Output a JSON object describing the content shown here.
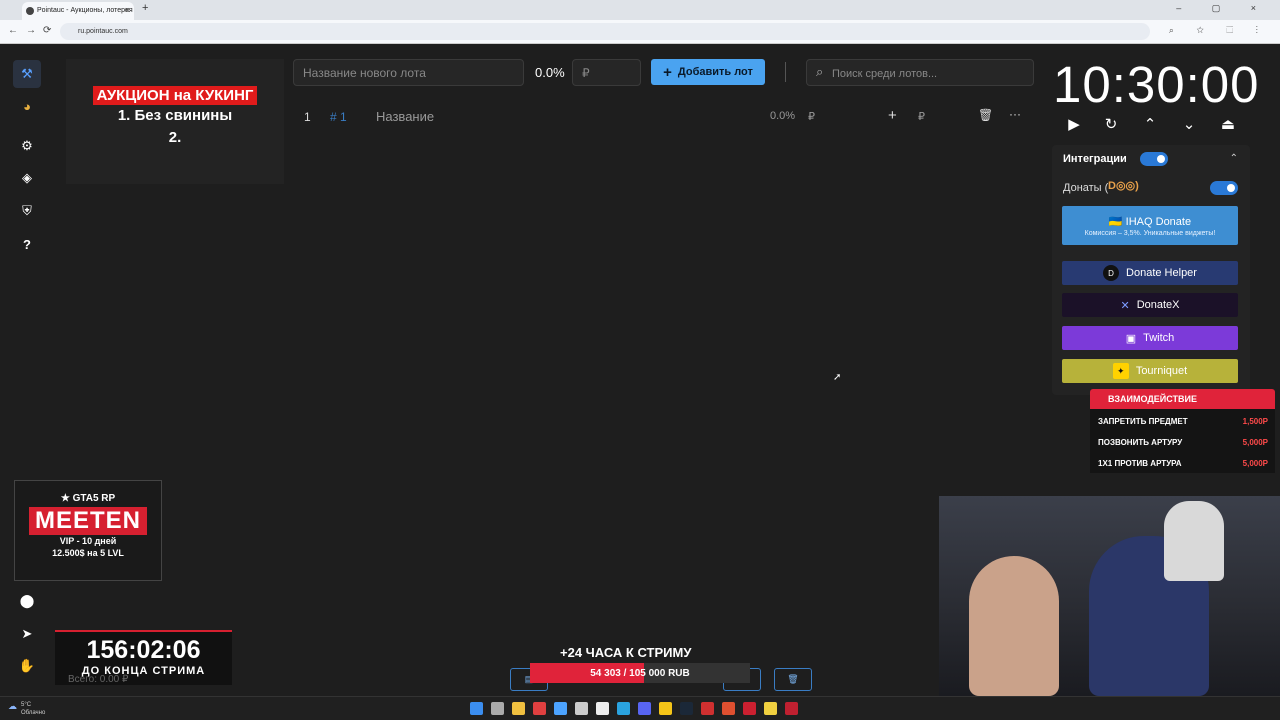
{
  "browser": {
    "tab_title": "Pointauc - Аукционы, лотерея",
    "tab_close": "×",
    "new_tab": "+",
    "window_controls": "– ▢ ×",
    "back": "←",
    "forward": "→",
    "reload": "⟳",
    "url": "ru.pointauc.com",
    "tool_icons": "⌕ ☆ ⬚ ⋮"
  },
  "sidebar": {
    "icons": [
      "hammer-icon",
      "pie-chart-icon",
      "gear-icon",
      "layers-icon",
      "shield-icon",
      "help-icon",
      "github-icon",
      "telegram-icon",
      "donate-hand-icon"
    ],
    "glyphs": [
      "⚒",
      "◕",
      "⚙",
      "◈",
      "⛨",
      "?",
      "⬤",
      "➤",
      "✋"
    ]
  },
  "banner": {
    "title": "АУКЦИОН на КУКИНГ",
    "line1": "1. Без свинины",
    "line2": "2."
  },
  "toolbar": {
    "new_lot_placeholder": "Название нового лота",
    "percent": "0.0%",
    "currency_placeholder": "₽",
    "add_button": "Добавить лот",
    "add_icon": "+",
    "search_placeholder": "Поиск среди лотов...",
    "search_icon": "⌕"
  },
  "lots": [
    {
      "num": "1",
      "id": "# 1",
      "name": "Название",
      "percent": "0.0%",
      "currency": "₽",
      "plus": "+",
      "currency2": "₽",
      "delete": "🗑",
      "more": "···"
    }
  ],
  "timer": {
    "value": "10:30:00",
    "controls": [
      "▶",
      "↻",
      "⌃",
      "⌄",
      "⏏"
    ]
  },
  "integrations": {
    "header": "Интеграции",
    "chevron": "⌃",
    "donates_label": "Донаты (",
    "donates_logo": "D◎◎)",
    "services": [
      {
        "name": "IHAQ Donate",
        "sub": "Комиссия – 3,5%. Уникальные виджеты!",
        "color": "#3e8ed2",
        "icon": "🇺🇦"
      },
      {
        "name": "Donate Helper",
        "color": "#283a72",
        "icon": "D"
      },
      {
        "name": "DonateX",
        "color": "#1b1128",
        "icon": "✕"
      },
      {
        "name": "Twitch",
        "color": "#7c3ad9",
        "icon": "▣"
      },
      {
        "name": "Tourniquet",
        "color": "#b7b23a",
        "icon": "✦"
      }
    ]
  },
  "interaction_overlay": {
    "title": "ВЗАИМОДЕЙСТВИЕ",
    "items": [
      {
        "label": "ЗАПРЕТИТЬ ПРЕДМЕТ",
        "price": "1,500Р"
      },
      {
        "label": "ПОЗВОНИТЬ АРТУРУ",
        "price": "5,000Р"
      },
      {
        "label": "1X1 ПРОТИВ АРТУРА",
        "price": "5,000Р"
      }
    ]
  },
  "gta_banner": {
    "rp": "★ GTA5 RP",
    "name": "MEETEN",
    "line1": "VIP - 10 дней",
    "line2": "12.500$ на 5 LVL"
  },
  "countdown": {
    "time": "156:02:06",
    "label": "ДО КОНЦА СТРИМА"
  },
  "total": "Всего: 0.00 ₽",
  "stream_goal": {
    "title": "+24 ЧАСА К СТРИМУ",
    "progress_text": "54 303 / 105 000 RUB",
    "current": 54303,
    "goal": 105000
  },
  "bottom_buttons": [
    "▤",
    "⇣",
    "⇅",
    "🗑"
  ],
  "taskbar": {
    "temp": "5°C",
    "weather": "Облачно",
    "apps": [
      "#3b8ef0",
      "#aaaaaa",
      "#f0c040",
      "#e04040",
      "#4ca3ff",
      "#cccccc",
      "#eeeeee",
      "#2aa3e0",
      "#5865f2",
      "#f5c518",
      "#1b2838",
      "#d03030",
      "#e05030",
      "#cc2030",
      "#f0d040",
      "#c02030"
    ]
  }
}
